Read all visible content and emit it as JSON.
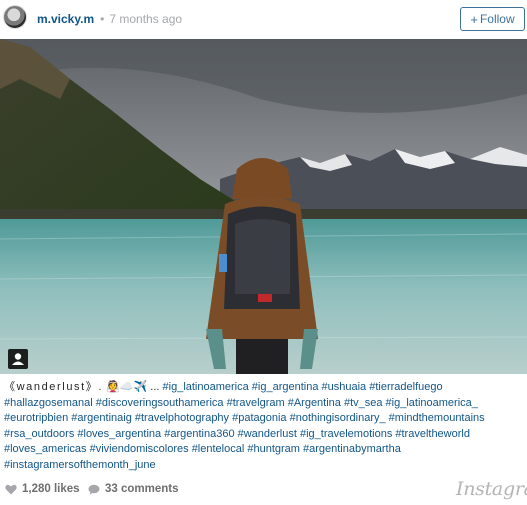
{
  "header": {
    "username": "m.vicky.m",
    "separator": "•",
    "time_ago": "7 months ago",
    "follow_plus": "+",
    "follow_label": "Follow"
  },
  "caption": {
    "prefix": "《wanderlust》.",
    "emoji": "👰☁️✈️",
    "ellipsis": "...",
    "hashtags": "#ig_latinoamerica #ig_argentina #ushuaia #tierradelfuego #hallazgosemanal #discoveringsouthamerica #travelgram #Argentina #tv_sea #ig_latinoamerica_ #eurotripbien #argentinaig #travelphotography #patagonia #nothingisordinary_ #mindthemountains #rsa_outdoors #loves_argentina #argentina360 #wanderlust #ig_travelemotions #traveltheworld #loves_americas #viviendomiscolores #lentelocal #huntgram #argentinabymartha #instagramersofthemonth_june"
  },
  "footer": {
    "likes": "1,280 likes",
    "comments": "33 comments",
    "brand": "Instagram"
  },
  "colors": {
    "link": "#125688",
    "follow": "#3f729b",
    "muted": "#a5a7aa"
  },
  "icons": [
    "avatar",
    "user-tag-icon",
    "heart-icon",
    "comment-icon"
  ]
}
